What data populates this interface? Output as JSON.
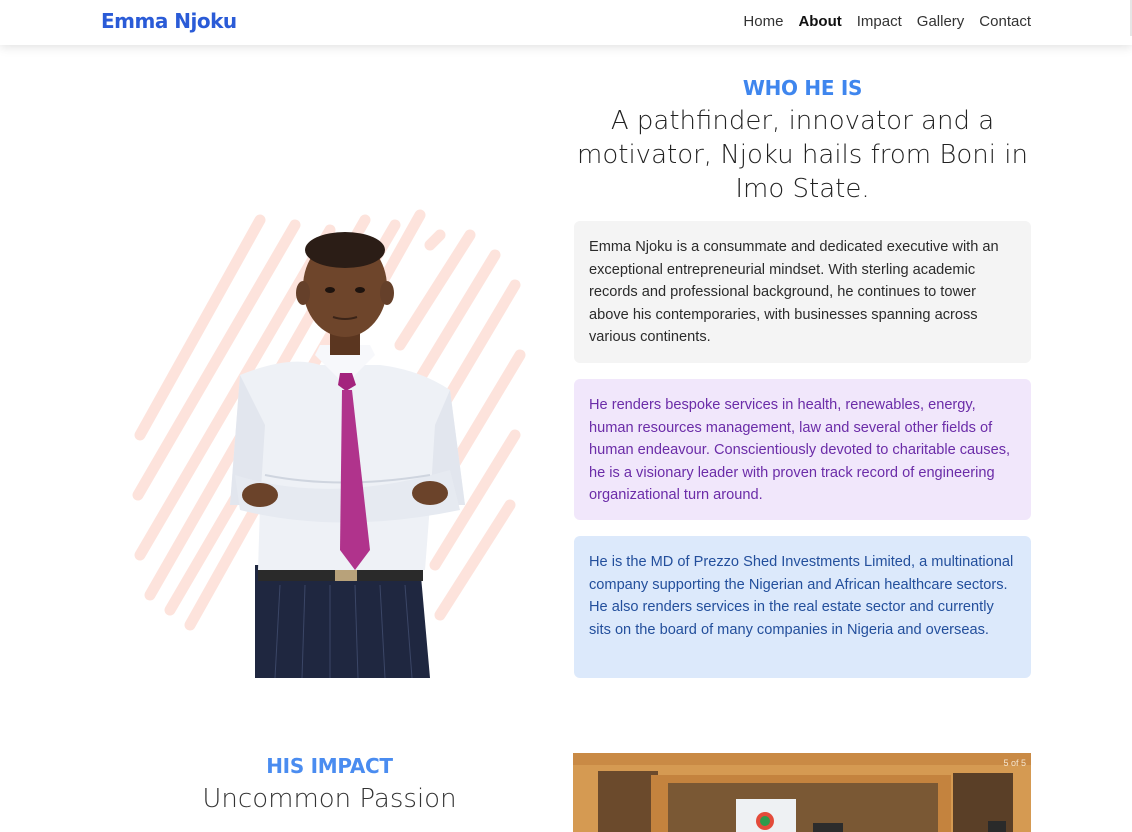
{
  "navbar": {
    "brand": "Emma Njoku",
    "links": [
      {
        "label": "Home",
        "active": false
      },
      {
        "label": "About",
        "active": true
      },
      {
        "label": "Impact",
        "active": false
      },
      {
        "label": "Gallery",
        "active": false
      },
      {
        "label": "Contact",
        "active": false
      }
    ]
  },
  "about": {
    "eyebrow": "WHO HE IS",
    "headline": "A pathfinder, innovator and a motivator, Njoku hails from Boni in Imo State.",
    "cards": [
      {
        "text": "Emma Njoku is a consummate and dedicated executive with an exceptional entrepreneurial mindset. With sterling academic records and professional background, he continues to tower above his contemporaries, with businesses spanning across various continents."
      },
      {
        "text": "He renders bespoke services in health, renewables, energy, human resources management, law and several other fields of human endeavour. Conscientiously devoted to charitable causes, he is a visionary leader with proven track record of engineering organizational turn around."
      },
      {
        "text": "He is the MD of Prezzo Shed Investments Limited, a multinational company supporting the Nigerian and African healthcare sectors. He also renders services in the real estate sector and currently sits on the board of many companies in Nigeria and overseas."
      }
    ]
  },
  "impact": {
    "eyebrow": "HIS IMPACT",
    "title": "Uncommon Passion",
    "slide_counter": "5 of 5"
  },
  "colors": {
    "brand": "#2a5bd7",
    "eyebrow": "#3f86ee",
    "card_gray": "#f4f4f4",
    "card_purple": "#f1e7fb",
    "card_blue": "#dce9fb"
  }
}
